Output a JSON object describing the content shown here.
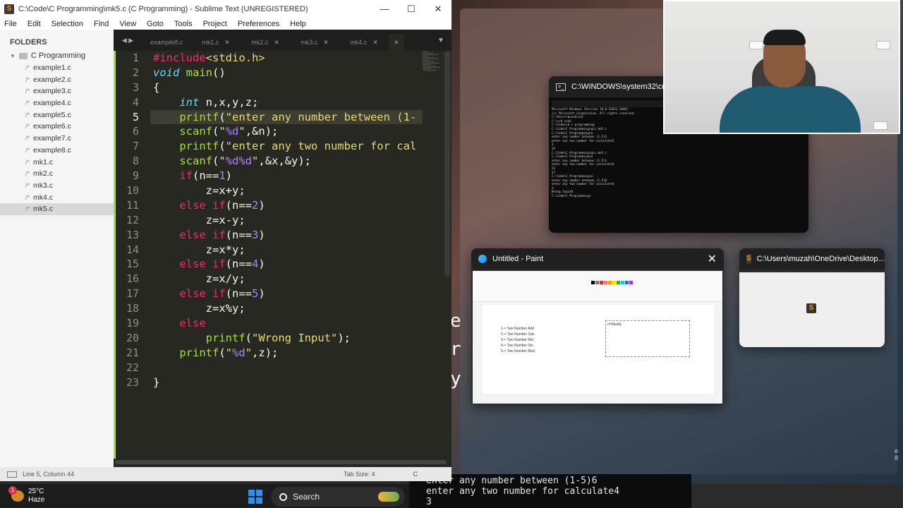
{
  "sublime": {
    "title": "C:\\Code\\C Programming\\mk5.c (C Programming) - Sublime Text (UNREGISTERED)",
    "controls": [
      "—",
      "☐",
      "✕"
    ],
    "menu": [
      "File",
      "Edit",
      "Selection",
      "Find",
      "View",
      "Goto",
      "Tools",
      "Project",
      "Preferences",
      "Help"
    ],
    "sidebar": {
      "heading": "FOLDERS",
      "folder": "C Programming",
      "files": [
        "example1.c",
        "example2.c",
        "example3.c",
        "example4.c",
        "example5.c",
        "example6.c",
        "example7.c",
        "example8.c",
        "mk1.c",
        "mk2.c",
        "mk3.c",
        "mk4.c",
        "mk5.c"
      ],
      "active_file": "mk5.c"
    },
    "tabs": [
      "example8.c",
      "mk1.c",
      "mk2.c",
      "mk3.c",
      "mk4.c",
      ""
    ],
    "active_line": 5,
    "status": {
      "position": "Line 5, Column 44",
      "tab_size": "Tab Size: 4",
      "syntax": "C"
    }
  },
  "cmd_window": {
    "title": "C:\\WINDOWS\\system32\\cmd.",
    "lines": [
      "Microsoft Windows [Version 10.0.22621.1848]",
      "(c) Microsoft Corporation. All rights reserved.",
      "",
      "C:\\Users\\muzah>cd\\",
      "",
      "C:\\>cd code",
      "",
      "C:\\Code>cd c programming",
      "",
      "C:\\Code\\C Programming>gcc mk5.c",
      "",
      "C:\\Code\\C Programming>a",
      "enter any number between (1-5)3",
      "enter any two number for calculate5",
      "3",
      "15",
      "C:\\Code\\C Programming>gcc mk5.c",
      "",
      "C:\\Code\\C Programming>a",
      "enter any number between (1-5)1",
      "enter any two number for calculate4",
      "23",
      "27",
      "C:\\Code\\C Programming>a",
      "enter any number between (1-5)6",
      "enter any two number for calculate4",
      "3",
      "Wrong Input0",
      "C:\\Code\\C Programming>"
    ]
  },
  "paint_window": {
    "title": "Untitled - Paint",
    "menu_items": [
      "1-> Two Number Add",
      "2-> Two Number Sub",
      "3-> Two Number Mul",
      "4-> Two Number Div",
      "5-> Two Number Mod"
    ],
    "box_label": "n=5&x&y"
  },
  "onedrive_window": {
    "title": "C:\\Users\\muzah\\OneDrive\\Desktop..."
  },
  "terminal_strip": {
    "lines": [
      "enter any number between (1-5)6",
      "enter any two number for calculate4",
      "3"
    ]
  },
  "taskbar": {
    "temperature": "25°C",
    "condition": "Haze",
    "badge": "1",
    "search_label": "Search"
  },
  "side_numbers": "e\n8"
}
